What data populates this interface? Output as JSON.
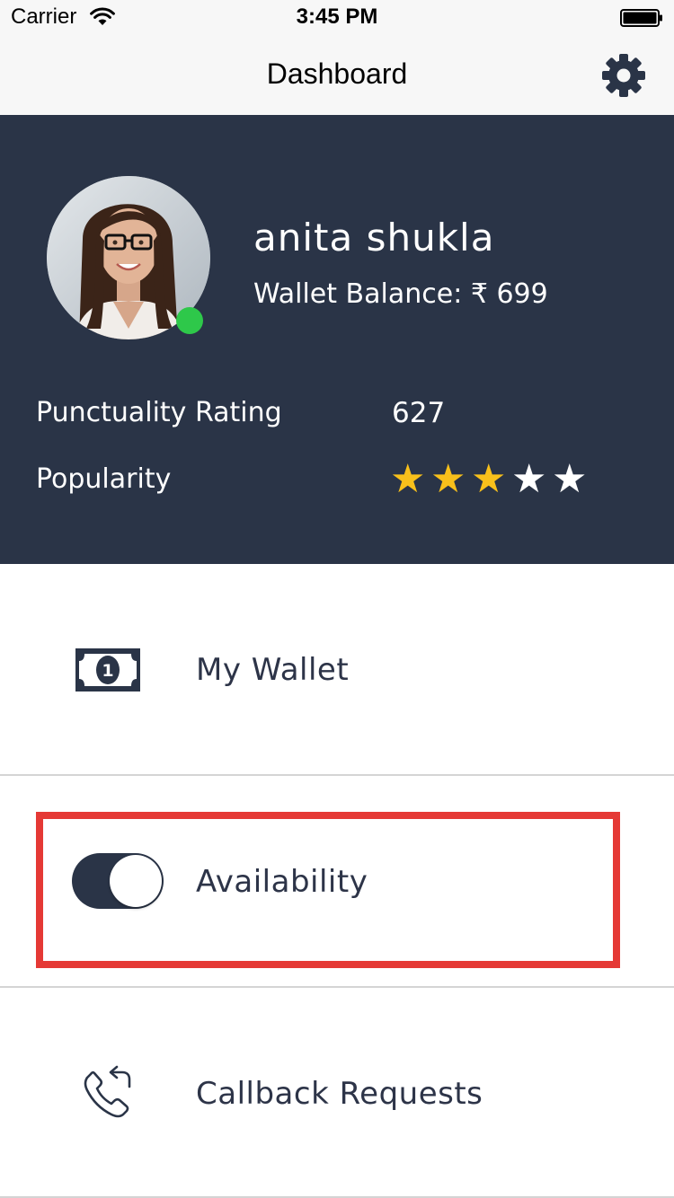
{
  "status_bar": {
    "carrier": "Carrier",
    "time": "3:45 PM",
    "wifi_icon": "wifi-icon",
    "battery_icon": "battery-full-icon"
  },
  "nav": {
    "title": "Dashboard",
    "settings_icon": "gear-icon"
  },
  "profile": {
    "name": "anita shukla",
    "wallet_balance": "Wallet Balance: ₹ 699",
    "online": true,
    "online_color": "#2ec84a",
    "panel_color": "#2a3447",
    "stats": {
      "punctuality_label": "Punctuality Rating",
      "punctuality_value": "627",
      "popularity_label": "Popularity",
      "popularity_rating": 3,
      "popularity_max": 5,
      "star_filled_color": "#f8c01b",
      "star_empty_color": "#ffffff"
    }
  },
  "menu": {
    "items": [
      {
        "label": "My Wallet",
        "icon": "money-bill-icon"
      },
      {
        "label": "Availability",
        "icon": "toggle-switch",
        "toggle_on": true
      },
      {
        "label": "Callback Requests",
        "icon": "phone-callback-icon"
      }
    ]
  },
  "annotation": {
    "highlight_color": "#e53935",
    "highlighted_item": "Availability"
  }
}
